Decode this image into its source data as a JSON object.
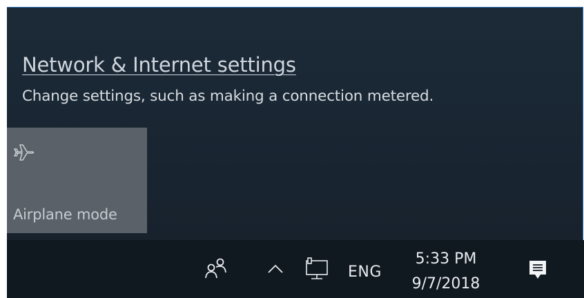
{
  "network_flyout": {
    "settings_link": "Network & Internet settings",
    "settings_description": "Change settings, such as making a connection metered.",
    "quick_action": {
      "label": "Airplane mode",
      "icon": "airplane-icon"
    }
  },
  "taskbar": {
    "people_icon": "people-icon",
    "show_hidden_icon": "chevron-up-icon",
    "network_icon": "ethernet-monitor-icon",
    "language": "ENG",
    "clock": {
      "time": "5:33 PM",
      "date": "9/7/2018"
    },
    "action_center_icon": "action-center-icon"
  },
  "colors": {
    "flyout_background": "#1a2633",
    "taskbar_background": "#101820",
    "tile_background": "#5a6169",
    "accent_border": "#2e6fb0",
    "text": "#d8dde2"
  }
}
